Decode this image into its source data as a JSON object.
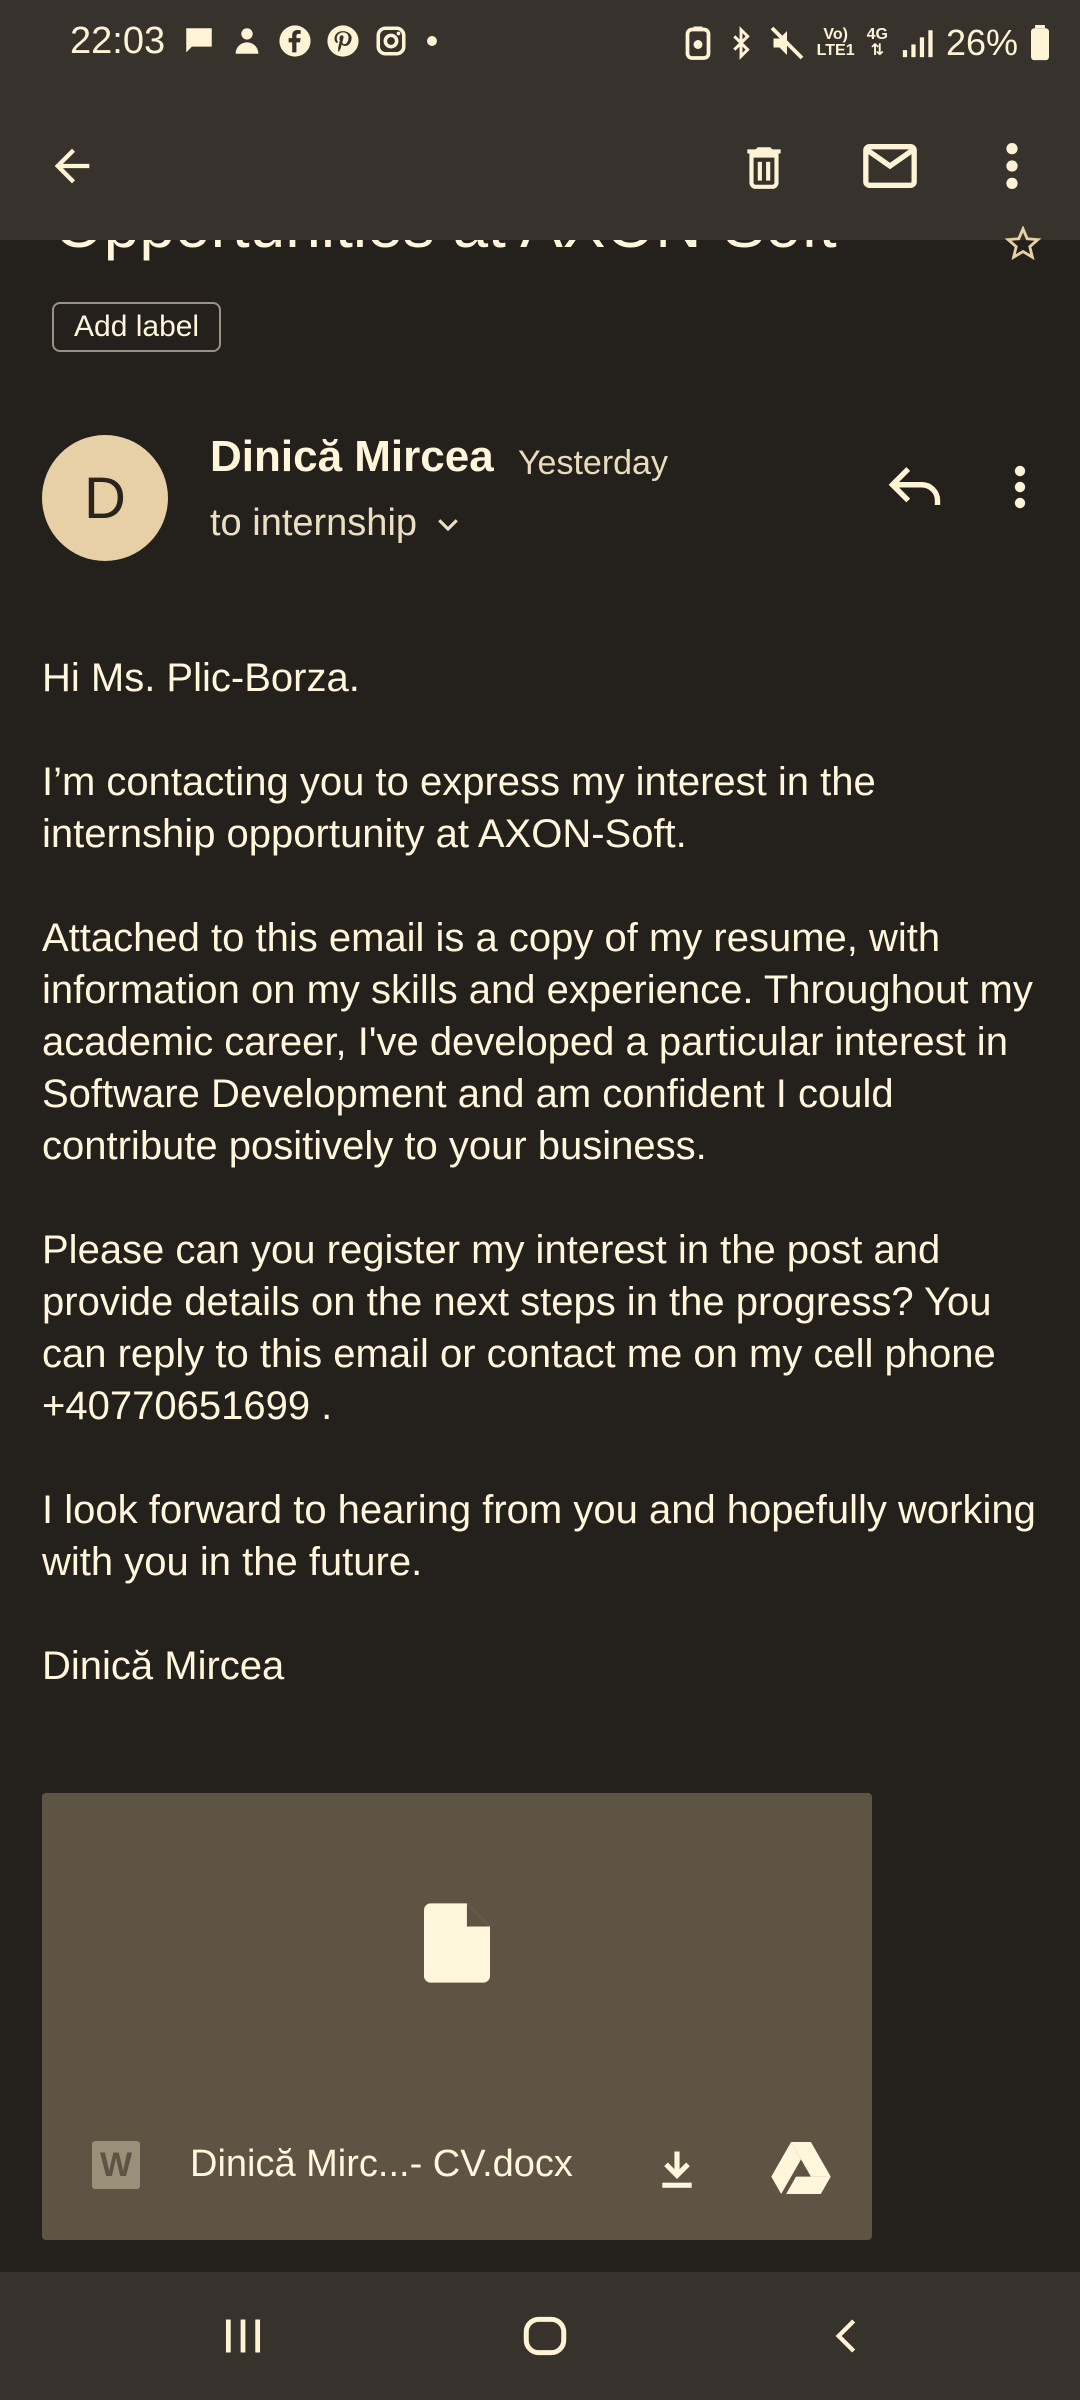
{
  "status_bar": {
    "time": "22:03",
    "battery": "26%",
    "network_top": "Vo)",
    "network_bottom": "LTE1",
    "gen": "4G"
  },
  "app_bar": {
    "back": "back-arrow-icon",
    "delete": "trash-icon",
    "mark_unread": "mail-icon",
    "more": "more-vert-icon"
  },
  "email": {
    "subject": "Opportunities at AXON-Soft",
    "add_label": "Add label",
    "sender_initial": "D",
    "sender_name": "Dinică Mircea",
    "time": "Yesterday",
    "recipient": "to internship",
    "body": [
      "Hi Ms. Plic-Borza.",
      "I’m contacting you to express my interest in the internship opportunity at AXON-Soft.",
      "Attached to this email is a copy of my resume, with information on my skills and experience. Throughout my academic career, I've developed a particular interest in Software Development and am confident I could contribute positively to your business.",
      "Please can you register my interest in the post and provide details on the next steps in the progress? You can reply to this email or contact me on my cell phone +40770651699 .",
      "I look forward to hearing from you and hopefully working with you in the future.",
      "Dinică Mircea"
    ]
  },
  "attachment": {
    "type_letter": "W",
    "filename": "Dinică Mirc...- CV.docx"
  },
  "colors": {
    "background": "#24201b",
    "bar": "#37322b",
    "text": "#fff6dc",
    "avatar": "#e8d0a6",
    "attachment": "#5d5444"
  }
}
